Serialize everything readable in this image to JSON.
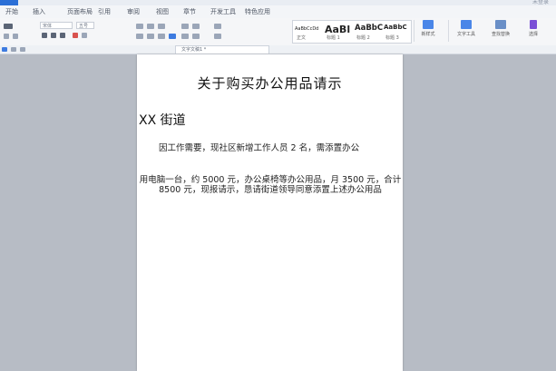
{
  "menubar": {
    "file_label": "文件",
    "tabs": [
      "开始",
      "插入",
      "页面布局",
      "引用",
      "审阅",
      "视图",
      "章节",
      "开发工具",
      "特色应用"
    ],
    "right_text": "未登录"
  },
  "ribbon": {
    "font_name": "宋体",
    "font_size": "五号",
    "styles": [
      {
        "sample": "AaBbCcDd",
        "name": "正文"
      },
      {
        "sample": "AaBl",
        "name": "标题 1"
      },
      {
        "sample": "AaBbC",
        "name": "标题 2"
      },
      {
        "sample": "AaBbC",
        "name": "标题 3"
      }
    ],
    "new_style_label": "新样式",
    "find_label": "文字工具",
    "select_label": "查找替换",
    "more_label": "选择"
  },
  "doc_tab": {
    "label": "文字文稿1 *"
  },
  "document": {
    "title": "关于购买办公用品请示",
    "addressee": "XX 街道",
    "para1": "因工作需要，现社区新增工作人员 2 名，需添置办公",
    "para2": "用电脑一台，约 5000 元，办公桌椅等办公用品，月 3500 元，合计 8500 元，现报请示，恳请街道领导同意添置上述办公用品"
  },
  "colors": {
    "accent": "#2b6fd6",
    "background": "#b7bcc5",
    "page": "#ffffff"
  }
}
